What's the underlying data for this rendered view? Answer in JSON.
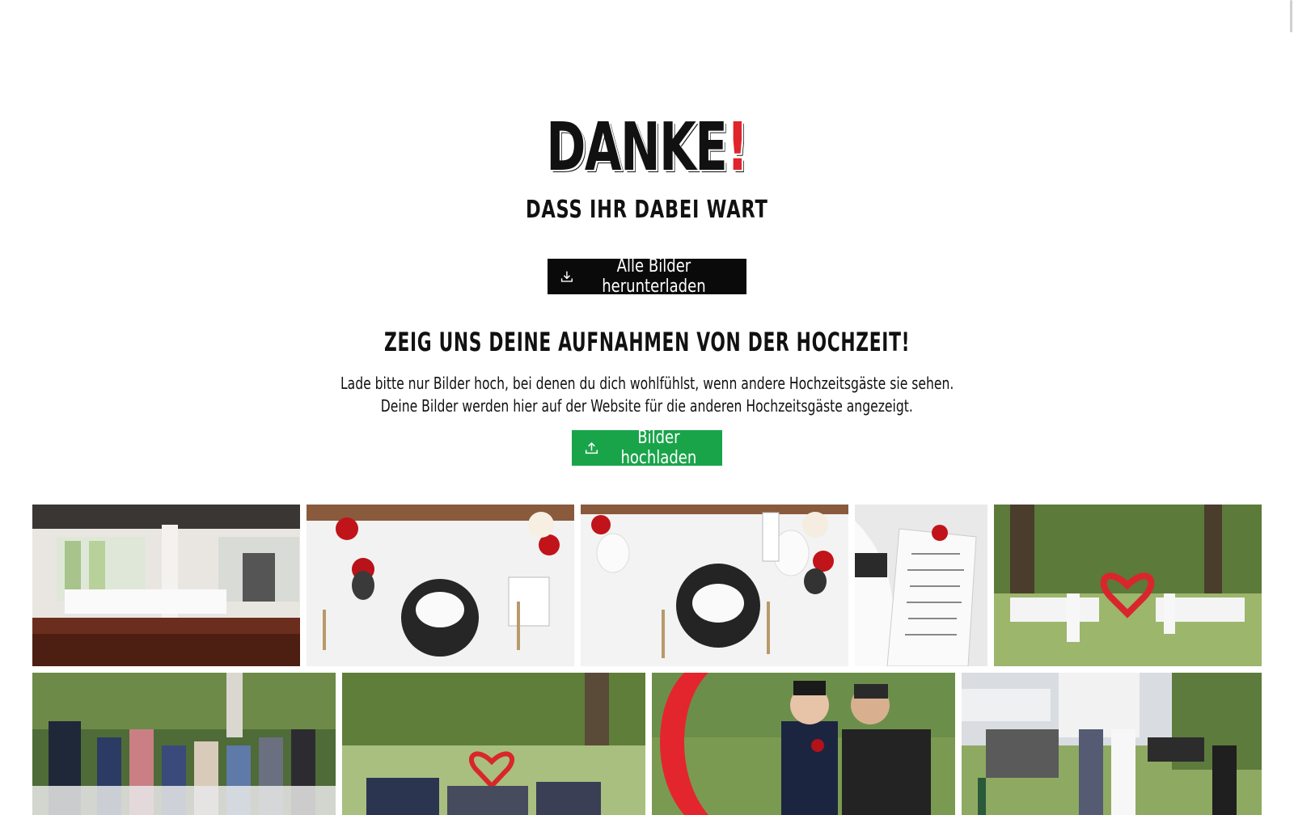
{
  "logo": {
    "text": "DANKE",
    "exclamation": "!"
  },
  "hero": {
    "subtitle": "DASS IHR DABEI WART"
  },
  "download_button": {
    "label": "Alle Bilder herunterladen",
    "icon": "download-icon"
  },
  "upload_section": {
    "heading": "ZEIG UNS DEINE AUFNAHMEN VON DER HOCHZEIT!",
    "line1": "Lade bitte nur Bilder hoch, bei denen du dich wohlfühlst, wenn andere Hochzeitsgäste sie sehen.",
    "line2": "Deine Bilder werden hier auf der Website für die anderen Hochzeitsgäste angezeigt.",
    "button_label": "Bilder hochladen",
    "button_icon": "upload-icon"
  },
  "colors": {
    "accent_red": "#e0242b",
    "upload_green": "#1aa44a",
    "dark": "#0a0a0a"
  },
  "gallery": [
    {
      "name": "photo-hall-interior"
    },
    {
      "name": "photo-table-setting-1"
    },
    {
      "name": "photo-table-setting-2"
    },
    {
      "name": "photo-menu-card"
    },
    {
      "name": "photo-garden-ceremony-heart"
    },
    {
      "name": "photo-guests-seated"
    },
    {
      "name": "photo-ceremony-wide"
    },
    {
      "name": "photo-groom-and-friend"
    },
    {
      "name": "photo-bride-walk"
    }
  ]
}
